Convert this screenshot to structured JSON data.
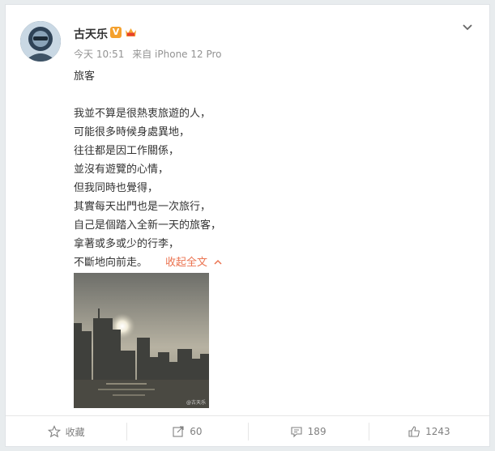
{
  "user": {
    "name": "古天乐",
    "verified_badge": "V",
    "vip_badge_icon": "vip-crown-icon"
  },
  "post_meta": {
    "time": "今天 10:51",
    "source": "来自 iPhone 12 Pro"
  },
  "post": {
    "title": "旅客",
    "lines": [
      "我並不算是很熱衷旅遊的人，",
      "可能很多時候身處異地，",
      "往往都是因工作關係，",
      "並沒有遊覽的心情，",
      "但我同時也覺得，",
      "其實每天出門也是一次旅行，",
      "自己是個踏入全新一天的旅客，",
      "拿著或多或少的行李，",
      "不斷地向前走。"
    ],
    "collapse_label": "收起全文",
    "collapse_arrow": "^"
  },
  "photo": {
    "watermark": "@古天乐"
  },
  "actions": {
    "favorite_label": "收藏",
    "repost_count": "60",
    "comment_count": "189",
    "like_count": "1243"
  },
  "colors": {
    "accent": "#eb7350",
    "meta_gray": "#939393",
    "badge_orange": "#f4a12e"
  }
}
